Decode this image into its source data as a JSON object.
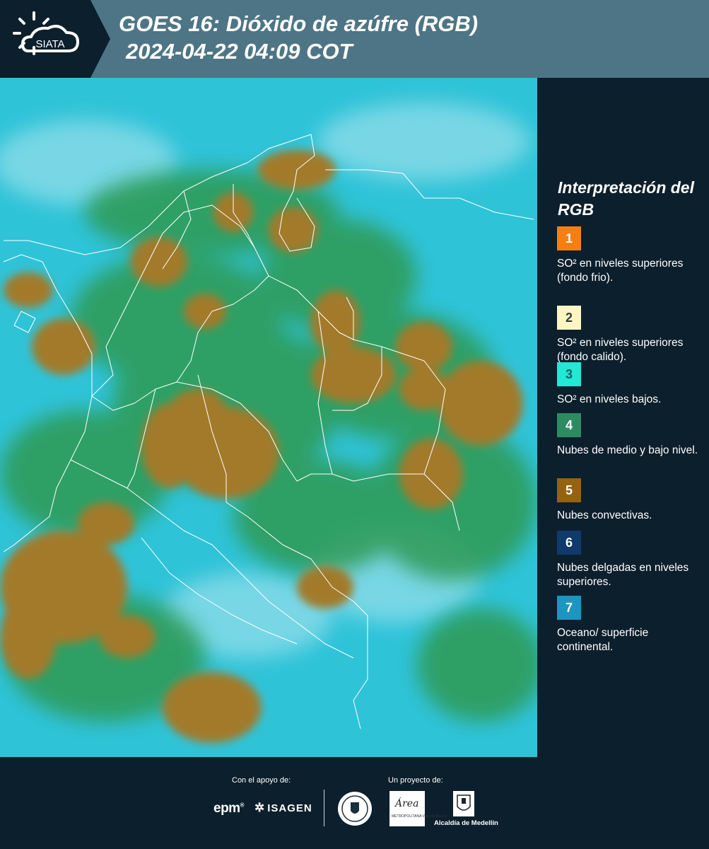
{
  "header": {
    "logo_text": "SIATA",
    "title": "GOES 16: Dióxido de azúfre (RGB)",
    "datetime": "2024-04-22 04:09 COT"
  },
  "map": {
    "base_color": "#2fc3d8",
    "convective_color": "#a27a2c",
    "low_cloud_color": "#2f9a52",
    "border_color": "#ffffff"
  },
  "legend": {
    "title": "Interpretación del RGB",
    "items": [
      {
        "number": "1",
        "label": "SO² en niveles superiores (fondo frio).",
        "color": "#f77f12",
        "text_color": "#ffffff"
      },
      {
        "number": "2",
        "label": "SO² en niveles superiores (fondo calido).",
        "color": "#fdf6c2",
        "text_color": "#3a3a3a"
      },
      {
        "number": "3",
        "label": "SO² en niveles bajos.",
        "color": "#22e8d6",
        "text_color": "#155f66"
      },
      {
        "number": "4",
        "label": "Nubes de medio y bajo nivel.",
        "color": "#2f8a62",
        "text_color": "#ffffff"
      },
      {
        "number": "5",
        "label": "Nubes convectivas.",
        "color": "#94630f",
        "text_color": "#ffffff"
      },
      {
        "number": "6",
        "label": "Nubes delgadas en niveles superiores.",
        "color": "#0f3a6a",
        "text_color": "#ffffff"
      },
      {
        "number": "7",
        "label": "Oceano/ superficie continental.",
        "color": "#1c96bf",
        "text_color": "#ffffff"
      }
    ]
  },
  "footer": {
    "support_caption": "Con el apoyo de:",
    "project_caption": "Un proyecto de:",
    "epm": "epm",
    "isagen": "ISAGEN",
    "area_word": "Área",
    "area_sub": "METROPOLITANA Valle de Aburrá",
    "alcaldia": "Alcaldía de Medellín"
  }
}
